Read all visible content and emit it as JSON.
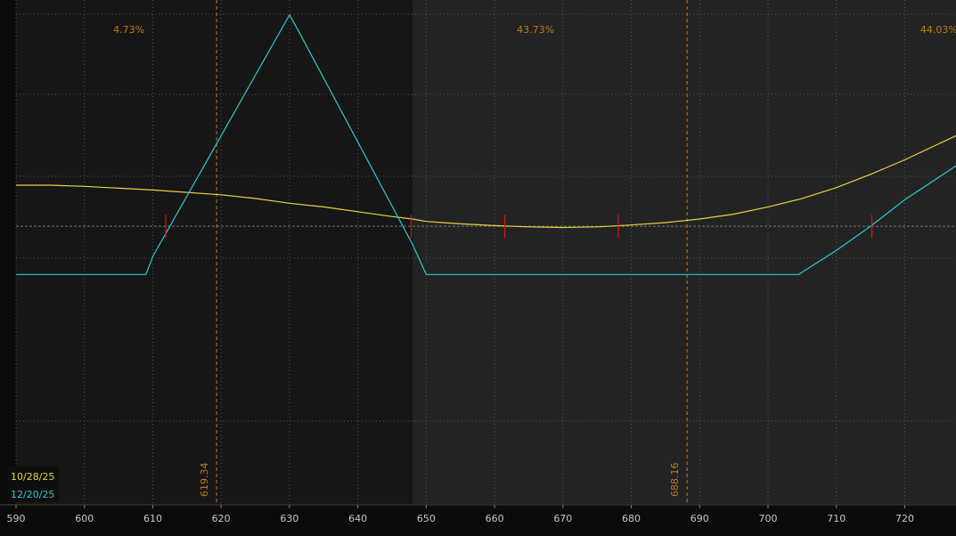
{
  "colors": {
    "background": "#0b0b0b",
    "plot_left_zone": "#161616",
    "plot_right_zone": "#232323",
    "grid": "#555555",
    "zero_line": "#777777",
    "marker_lines": "#c07a1a",
    "pct_labels": "#c07a1a",
    "tick_labels": "#c8c8c8",
    "breakeven_ticks": "#e01010",
    "legend_bg": "#0e0e0e"
  },
  "chart_data": {
    "type": "line",
    "title": "",
    "xlabel": "",
    "ylabel": "",
    "xlim": [
      590,
      727.5
    ],
    "ylim": [
      -23,
      18
    ],
    "x_ticks": [
      "590",
      "600",
      "610",
      "620",
      "630",
      "640",
      "650",
      "660",
      "670",
      "680",
      "690",
      "700",
      "710",
      "720"
    ],
    "grid": true,
    "zero_line": 0,
    "shaded_split_x": 648,
    "zone_percent_labels": [
      {
        "text": "4.73%",
        "x": 606.5
      },
      {
        "text": "43.73%",
        "x": 666
      },
      {
        "text": "44.03%",
        "x": 725
      }
    ],
    "marker_lines": [
      {
        "x": 619.34,
        "label": "619.34"
      },
      {
        "x": 688.16,
        "label": "688.16"
      }
    ],
    "series": [
      {
        "name": "10/28/25",
        "color": "#e8d24a",
        "x": [
          590,
          595,
          600,
          610,
          620,
          625,
          630,
          635,
          640,
          645,
          648,
          650,
          655,
          660,
          665,
          670,
          675,
          680,
          685,
          690,
          695,
          700,
          705,
          710,
          715,
          720,
          727.5
        ],
        "y": [
          3.4,
          3.4,
          3.3,
          3.0,
          2.6,
          2.3,
          1.9,
          1.6,
          1.2,
          0.8,
          0.6,
          0.4,
          0.2,
          0.05,
          -0.05,
          -0.1,
          -0.05,
          0.1,
          0.3,
          0.6,
          1.0,
          1.6,
          2.3,
          3.2,
          4.3,
          5.5,
          7.5
        ]
      },
      {
        "name": "12/20/25",
        "color": "#2ec8d4",
        "x": [
          590,
          609,
          610,
          630,
          631,
          648,
          650,
          700,
          704.5,
          705,
          710,
          715,
          720,
          727.5
        ],
        "y": [
          -4,
          -4,
          -2.5,
          17.5,
          16.5,
          -1.5,
          -4,
          -4,
          -4,
          -3.8,
          -2,
          0,
          2.2,
          5
        ]
      }
    ],
    "breakeven_points": [
      611.9,
      647.8,
      661.5,
      678.1,
      715.2
    ],
    "legend": {
      "placement": "bottom-left",
      "entries": [
        {
          "label": "10/28/25",
          "color": "#e8d24a"
        },
        {
          "label": "12/20/25",
          "color": "#2ec8d4"
        }
      ]
    }
  }
}
